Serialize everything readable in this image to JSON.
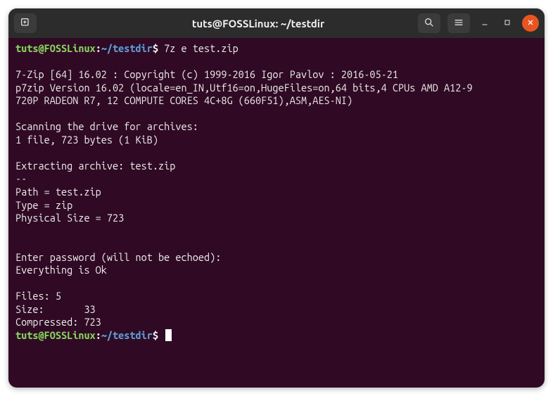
{
  "title": "tuts@FOSSLinux: ~/testdir",
  "prompt": {
    "user_host": "tuts@FOSSLinux",
    "colon": ":",
    "path": "~/testdir",
    "dollar": "$"
  },
  "command1": "7z e test.zip",
  "output_lines": [
    "",
    "7-Zip [64] 16.02 : Copyright (c) 1999-2016 Igor Pavlov : 2016-05-21",
    "p7zip Version 16.02 (locale=en_IN,Utf16=on,HugeFiles=on,64 bits,4 CPUs AMD A12-9",
    "720P RADEON R7, 12 COMPUTE CORES 4C+8G (660F51),ASM,AES-NI)",
    "",
    "Scanning the drive for archives:",
    "1 file, 723 bytes (1 KiB)",
    "",
    "Extracting archive: test.zip",
    "--",
    "Path = test.zip",
    "Type = zip",
    "Physical Size = 723",
    "",
    "",
    "Enter password (will not be echoed):",
    "Everything is Ok",
    "",
    "Files: 5",
    "Size:       33",
    "Compressed: 723"
  ],
  "icons": {
    "new_tab": "new-tab-icon",
    "search": "search-icon",
    "menu": "hamburger-icon",
    "minimize": "minimize-icon",
    "maximize": "maximize-icon",
    "close": "close-icon"
  }
}
